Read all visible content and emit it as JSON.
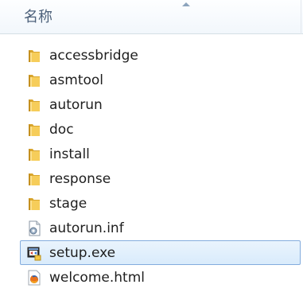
{
  "header": {
    "name_column": "名称",
    "sort_indicator": "sort-ascending-icon"
  },
  "files": [
    {
      "name": "accessbridge",
      "icon": "folder-icon",
      "selected": false
    },
    {
      "name": "asmtool",
      "icon": "folder-icon",
      "selected": false
    },
    {
      "name": "autorun",
      "icon": "folder-icon",
      "selected": false
    },
    {
      "name": "doc",
      "icon": "folder-icon",
      "selected": false
    },
    {
      "name": "install",
      "icon": "folder-icon",
      "selected": false
    },
    {
      "name": "response",
      "icon": "folder-icon",
      "selected": false
    },
    {
      "name": "stage",
      "icon": "folder-icon",
      "selected": false
    },
    {
      "name": "autorun.inf",
      "icon": "settings-file-icon",
      "selected": false
    },
    {
      "name": "setup.exe",
      "icon": "installer-exe-icon",
      "selected": true
    },
    {
      "name": "welcome.html",
      "icon": "firefox-html-icon",
      "selected": false
    }
  ],
  "colors": {
    "folder": "#f0c040",
    "selection_border": "#84acdd",
    "selection_fill": "#dceefc",
    "header_text": "#4c607a"
  }
}
